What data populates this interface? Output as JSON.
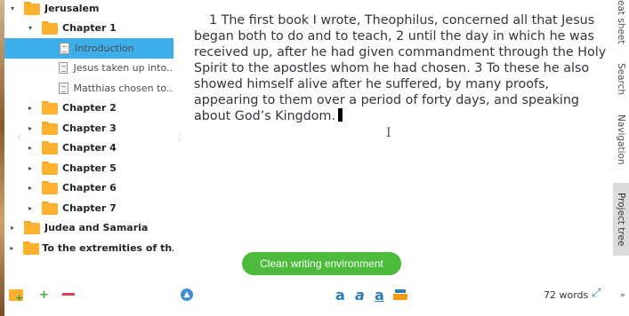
{
  "tree": {
    "items": [
      {
        "label": "Jerusalem",
        "type": "folder",
        "level": 0,
        "arrow": "▾"
      },
      {
        "label": "Chapter 1",
        "type": "folder",
        "level": 1,
        "arrow": "▾"
      },
      {
        "label": "Introduction",
        "type": "document",
        "level": 2,
        "selected": true
      },
      {
        "label": "Jesus taken up into...",
        "type": "document",
        "level": 2
      },
      {
        "label": "Matthias chosen to...",
        "type": "document",
        "level": 2
      },
      {
        "label": "Chapter 2",
        "type": "folder",
        "level": 1,
        "arrow": "▸"
      },
      {
        "label": "Chapter 3",
        "type": "folder",
        "level": 1,
        "arrow": "▸"
      },
      {
        "label": "Chapter 4",
        "type": "folder",
        "level": 1,
        "arrow": "▸"
      },
      {
        "label": "Chapter 5",
        "type": "folder",
        "level": 1,
        "arrow": "▸"
      },
      {
        "label": "Chapter 6",
        "type": "folder",
        "level": 1,
        "arrow": "▸"
      },
      {
        "label": "Chapter 7",
        "type": "folder",
        "level": 1,
        "arrow": "▸"
      },
      {
        "label": "Judea and Samaria",
        "type": "folder",
        "level": 0,
        "arrow": "▸"
      },
      {
        "label": "To the extremities of th...",
        "type": "folder",
        "level": 0,
        "arrow": "▸"
      }
    ]
  },
  "editor": {
    "text": "1 The first book I wrote, Theophilus, concerned all that Jesus began both to do and to teach, 2 until the day in which he was received up, after he had given commandment through the Holy Spirit to the apostles whom he had chosen. 3 To these he also showed himself alive after he suffered, by many proofs, appearing to them over a period of forty days, and speaking about God’s Kingdom."
  },
  "dock_tabs": {
    "cheat_sheet": "eat sheet",
    "search": "Search",
    "navigation": "Navigation",
    "project_tree": "Project tree"
  },
  "clean_writing_label": "Clean writing environment",
  "status": {
    "word_count": "72 words"
  },
  "format_buttons": [
    "a",
    "a",
    "a"
  ],
  "colors": {
    "selection": "#3daee9",
    "folder": "#fdb12f",
    "clean_button": "#4cbb3c",
    "accent": "#2980b9"
  }
}
